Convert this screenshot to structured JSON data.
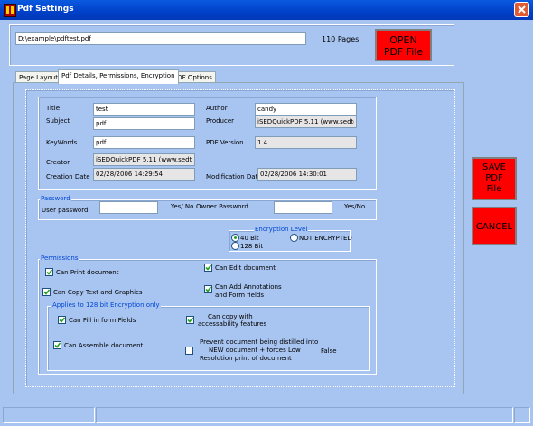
{
  "window": {
    "title": "Pdf Settings"
  },
  "file": {
    "path": "D:\\example\\pdftest.pdf",
    "pages": "110 Pages",
    "open_label_1": "OPEN",
    "open_label_2": "PDF File"
  },
  "tabs": [
    "Page Layout",
    "Pdf Details, Permissions, Encryption",
    "PDF Options"
  ],
  "details": {
    "title_label": "Title",
    "title_value": "test",
    "author_label": "Author",
    "author_value": "candy",
    "subject_label": "Subject",
    "subject_value": "pdf",
    "producer_label": "Producer",
    "producer_value": "iSEDQuickPDF 5.11 (www.sedtech",
    "keywords_label": "KeyWords",
    "keywords_value": "pdf",
    "version_label": "PDF Version",
    "version_value": "1.4",
    "creator_label": "Creator",
    "creator_value": "iSEDQuickPDF 5.11 (www.sedtech",
    "creation_label": "Creation Date",
    "creation_value": "02/28/2006 14:29:54",
    "modification_label": "Modification Date",
    "modification_value": "02/28/2006 14:30:01"
  },
  "password": {
    "group_title": "Password",
    "user_label": "User password",
    "user_value": "",
    "yesno_label_1": "Yes/ No",
    "owner_label": "Owner Password",
    "owner_value": "",
    "yesno_label_2": "Yes/No"
  },
  "encryption": {
    "group_title": "Encryption Level",
    "options": [
      "40 Bit",
      "128 Bit",
      "NOT ENCRYPTED"
    ],
    "selected": "40 Bit"
  },
  "permissions": {
    "group_title": "Permissions",
    "print": "Can Print document",
    "edit": "Can Edit document",
    "copy": "Can Copy Text and Graphics",
    "annotations_1": "Can Add Annotations",
    "annotations_2": "and Form fields",
    "sub_title": "Applies to 128 bit Encryption only",
    "fill": "Can Fill in form Fields",
    "access_1": "Can copy with",
    "access_2": "accessability features",
    "assemble": "Can Assemble document",
    "distill_1": "Prevent document being distilled into",
    "distill_2": "NEW document + forces Low",
    "distill_3": "Resolution print of document",
    "distill_value": "False"
  },
  "actions": {
    "save_1": "SAVE",
    "save_2": "PDF",
    "save_3": "File",
    "cancel": "CANCEL"
  },
  "colors": {
    "titlebar": "#0054e3",
    "window": "#a8c4f0",
    "action_button": "#ff0000",
    "group_title": "#0046d5"
  }
}
